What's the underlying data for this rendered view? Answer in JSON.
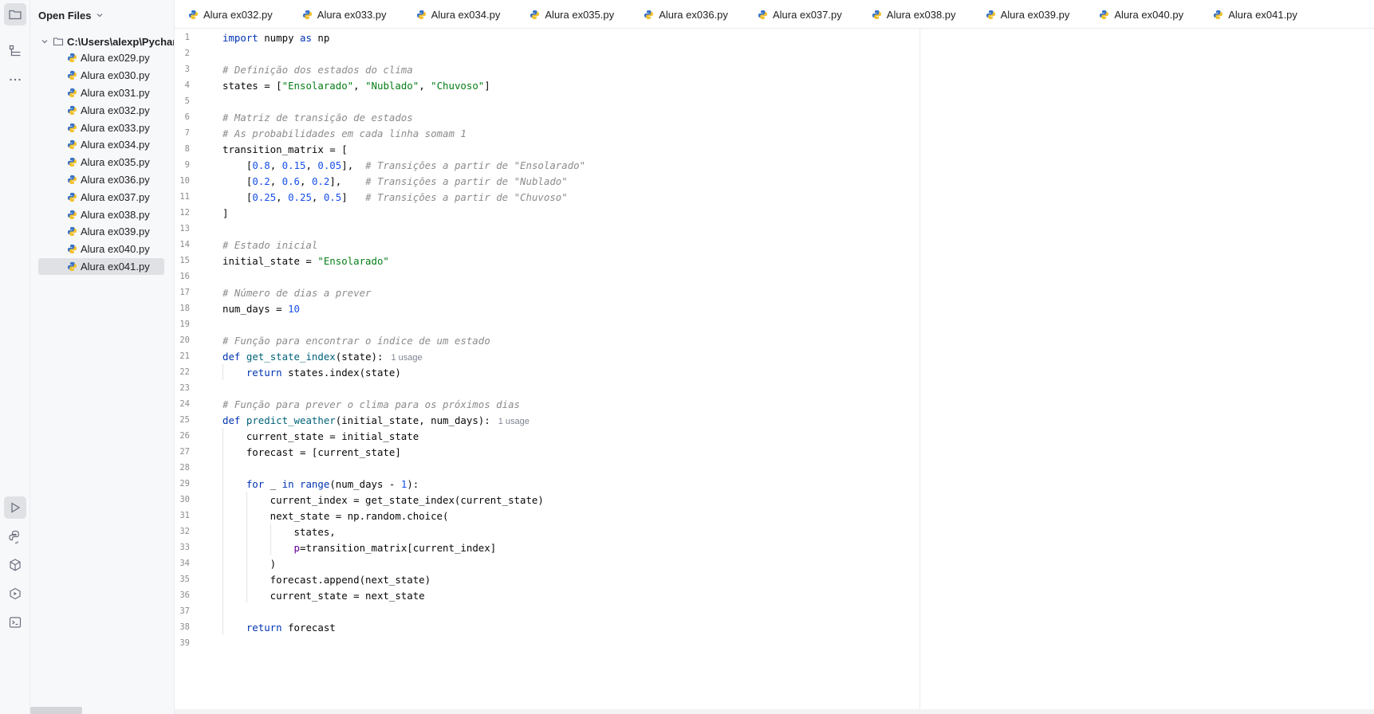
{
  "project_panel": {
    "title": "Open Files",
    "root": "C:\\Users\\alexp\\PycharmProjects",
    "files": [
      "Alura ex029.py",
      "Alura ex030.py",
      "Alura ex031.py",
      "Alura ex032.py",
      "Alura ex033.py",
      "Alura ex034.py",
      "Alura ex035.py",
      "Alura ex036.py",
      "Alura ex037.py",
      "Alura ex038.py",
      "Alura ex039.py",
      "Alura ex040.py",
      "Alura ex041.py"
    ],
    "selected_file": "Alura ex041.py"
  },
  "tabs": [
    "Alura ex032.py",
    "Alura ex033.py",
    "Alura ex034.py",
    "Alura ex035.py",
    "Alura ex036.py",
    "Alura ex037.py",
    "Alura ex038.py",
    "Alura ex039.py",
    "Alura ex040.py",
    "Alura ex041.py"
  ],
  "active_tab": "Alura ex041.py",
  "toolstrip_icons": [
    "folder-icon",
    "structure-icon",
    "more-icon",
    "run-icon",
    "python-console-icon",
    "python-packages-icon",
    "services-icon",
    "terminal-icon"
  ],
  "usage_hint": "1 usage",
  "code_lines": [
    "import numpy as np",
    "",
    "# Definição dos estados do clima",
    "states = [\"Ensolarado\", \"Nublado\", \"Chuvoso\"]",
    "",
    "# Matriz de transição de estados",
    "# As probabilidades em cada linha somam 1",
    "transition_matrix = [",
    "    [0.8, 0.15, 0.05],  # Transições a partir de \"Ensolarado\"",
    "    [0.2, 0.6, 0.2],    # Transições a partir de \"Nublado\"",
    "    [0.25, 0.25, 0.5]   # Transições a partir de \"Chuvoso\"",
    "]",
    "",
    "# Estado inicial",
    "initial_state = \"Ensolarado\"",
    "",
    "# Número de dias a prever",
    "num_days = 10",
    "",
    "# Função para encontrar o índice de um estado",
    "def get_state_index(state):",
    "    return states.index(state)",
    "",
    "# Função para prever o clima para os próximos dias",
    "def predict_weather(initial_state, num_days):",
    "    current_state = initial_state",
    "    forecast = [current_state]",
    "",
    "    for _ in range(num_days - 1):",
    "        current_index = get_state_index(current_state)",
    "        next_state = np.random.choice(",
    "            states,",
    "            p=transition_matrix[current_index]",
    "        )",
    "        forecast.append(next_state)",
    "        current_state = next_state",
    "",
    "    return forecast",
    ""
  ],
  "colors": {
    "keyword": "#0033b3",
    "function": "#00627a",
    "string": "#067d17",
    "number": "#1750eb",
    "comment": "#8c8c8c",
    "kwarg": "#660099",
    "selection": "#dfe1e5",
    "accent": "#3574f0"
  }
}
